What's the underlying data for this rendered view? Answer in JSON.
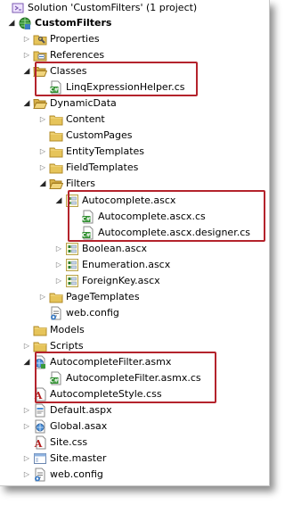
{
  "tree": [
    {
      "label": "Solution 'CustomFilters' (1 project)",
      "level": 0,
      "icon": "solution-icon",
      "arrow": "none"
    },
    {
      "label": "CustomFilters",
      "level": 1,
      "icon": "web-project-icon",
      "arrow": "open",
      "bold": true
    },
    {
      "label": "Properties",
      "level": 2,
      "icon": "properties-icon",
      "arrow": "closed"
    },
    {
      "label": "References",
      "level": 2,
      "icon": "references-icon",
      "arrow": "closed"
    },
    {
      "label": "Classes",
      "level": 2,
      "icon": "folder-open-icon",
      "arrow": "open"
    },
    {
      "label": "LinqExpressionHelper.cs",
      "level": 3,
      "icon": "cs-file-icon",
      "arrow": "none"
    },
    {
      "label": "DynamicData",
      "level": 2,
      "icon": "folder-open-icon",
      "arrow": "open"
    },
    {
      "label": "Content",
      "level": 3,
      "icon": "folder-icon",
      "arrow": "closed"
    },
    {
      "label": "CustomPages",
      "level": 3,
      "icon": "folder-icon",
      "arrow": "none"
    },
    {
      "label": "EntityTemplates",
      "level": 3,
      "icon": "folder-icon",
      "arrow": "closed"
    },
    {
      "label": "FieldTemplates",
      "level": 3,
      "icon": "folder-icon",
      "arrow": "closed"
    },
    {
      "label": "Filters",
      "level": 3,
      "icon": "folder-open-icon",
      "arrow": "open"
    },
    {
      "label": "Autocomplete.ascx",
      "level": 4,
      "icon": "ascx-file-icon",
      "arrow": "open"
    },
    {
      "label": "Autocomplete.ascx.cs",
      "level": 5,
      "icon": "cs-file-icon",
      "arrow": "none"
    },
    {
      "label": "Autocomplete.ascx.designer.cs",
      "level": 5,
      "icon": "cs-file-icon",
      "arrow": "none"
    },
    {
      "label": "Boolean.ascx",
      "level": 4,
      "icon": "ascx-file-icon",
      "arrow": "closed"
    },
    {
      "label": "Enumeration.ascx",
      "level": 4,
      "icon": "ascx-file-icon",
      "arrow": "closed"
    },
    {
      "label": "ForeignKey.ascx",
      "level": 4,
      "icon": "ascx-file-icon",
      "arrow": "closed"
    },
    {
      "label": "PageTemplates",
      "level": 3,
      "icon": "folder-icon",
      "arrow": "closed"
    },
    {
      "label": "web.config",
      "level": 3,
      "icon": "config-file-icon",
      "arrow": "none"
    },
    {
      "label": "Models",
      "level": 2,
      "icon": "folder-icon",
      "arrow": "none"
    },
    {
      "label": "Scripts",
      "level": 2,
      "icon": "folder-icon",
      "arrow": "closed"
    },
    {
      "label": "AutocompleteFilter.asmx",
      "level": 2,
      "icon": "asmx-file-icon",
      "arrow": "open"
    },
    {
      "label": "AutocompleteFilter.asmx.cs",
      "level": 3,
      "icon": "cs-file-icon",
      "arrow": "none"
    },
    {
      "label": "AutocompleteStyle.css",
      "level": 2,
      "icon": "css-file-icon",
      "arrow": "none"
    },
    {
      "label": "Default.aspx",
      "level": 2,
      "icon": "aspx-file-icon",
      "arrow": "closed"
    },
    {
      "label": "Global.asax",
      "level": 2,
      "icon": "asax-file-icon",
      "arrow": "closed"
    },
    {
      "label": "Site.css",
      "level": 2,
      "icon": "css-file-icon",
      "arrow": "none"
    },
    {
      "label": "Site.master",
      "level": 2,
      "icon": "master-file-icon",
      "arrow": "closed"
    },
    {
      "label": "web.config",
      "level": 2,
      "icon": "config-file-icon",
      "arrow": "closed"
    }
  ],
  "colors": {
    "highlight": "#b4232c",
    "folder": "#e6c45a"
  }
}
